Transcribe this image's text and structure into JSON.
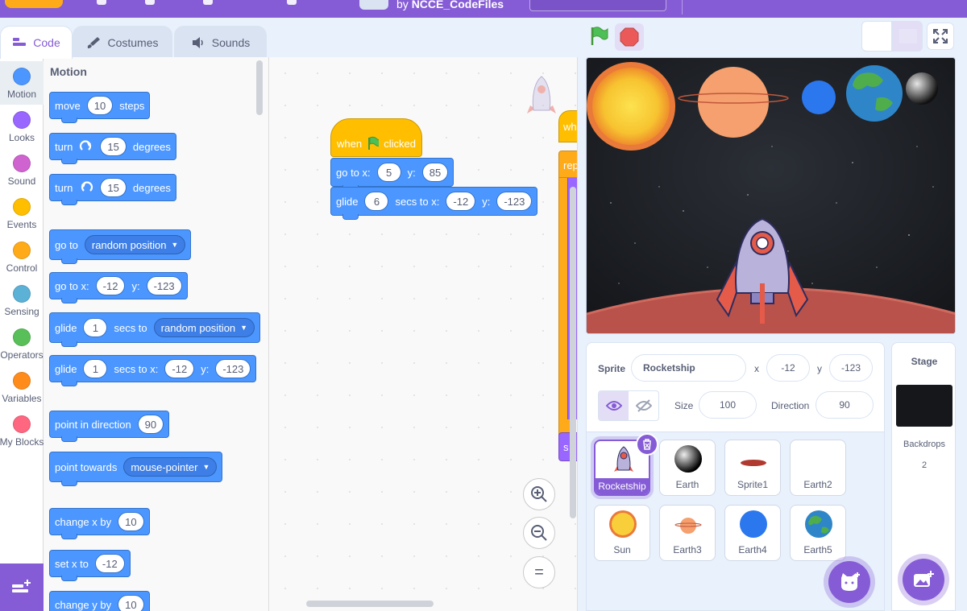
{
  "menubar": {
    "author_prefix": "by",
    "author": "NCCE_CodeFiles"
  },
  "tabs": {
    "code": "Code",
    "costumes": "Costumes",
    "sounds": "Sounds"
  },
  "categories": [
    {
      "label": "Motion",
      "color": "#4c97ff"
    },
    {
      "label": "Looks",
      "color": "#9966ff"
    },
    {
      "label": "Sound",
      "color": "#cf63cf"
    },
    {
      "label": "Events",
      "color": "#ffbf00"
    },
    {
      "label": "Control",
      "color": "#ffab19"
    },
    {
      "label": "Sensing",
      "color": "#5cb1d6"
    },
    {
      "label": "Operators",
      "color": "#59c059"
    },
    {
      "label": "Variables",
      "color": "#ff8c1a"
    },
    {
      "label": "My Blocks",
      "color": "#ff6680"
    }
  ],
  "palette": {
    "title": "Motion",
    "move": {
      "a": "move",
      "v": "10",
      "b": "steps"
    },
    "turn_right": {
      "a": "turn",
      "v": "15",
      "b": "degrees"
    },
    "turn_left": {
      "a": "turn",
      "v": "15",
      "b": "degrees"
    },
    "goto": {
      "a": "go to",
      "dd": "random position"
    },
    "gotoxy": {
      "a": "go to x:",
      "x": "-12",
      "b": "y:",
      "y": "-123"
    },
    "glide_to": {
      "a": "glide",
      "v": "1",
      "b": "secs to",
      "dd": "random position"
    },
    "glide_xy": {
      "a": "glide",
      "v": "1",
      "b": "secs to x:",
      "x": "-12",
      "c": "y:",
      "y": "-123"
    },
    "point_dir": {
      "a": "point in direction",
      "v": "90"
    },
    "point_towards": {
      "a": "point towards",
      "dd": "mouse-pointer"
    },
    "change_x": {
      "a": "change x by",
      "v": "10"
    },
    "set_x": {
      "a": "set x to",
      "v": "-12"
    },
    "change_y": {
      "a": "change y by",
      "v": "10"
    }
  },
  "script": {
    "hat": {
      "a": "when",
      "b": "clicked"
    },
    "gotoxy": {
      "a": "go to x:",
      "x": "5",
      "b": "y:",
      "y": "85"
    },
    "glide": {
      "a": "glide",
      "v": "6",
      "b": "secs to x:",
      "x": "-12",
      "c": "y:",
      "y": "-123"
    },
    "clip_hat": "wh",
    "clip_repeat": "rep",
    "clip_bottom": "s"
  },
  "zoom": {
    "reset": "="
  },
  "sprite_info": {
    "sprite_label": "Sprite",
    "sprite_name": "Rocketship",
    "x_label": "x",
    "x": "-12",
    "y_label": "y",
    "y": "-123",
    "size_label": "Size",
    "size": "100",
    "direction_label": "Direction",
    "direction": "90"
  },
  "sprites": [
    "Rocketship",
    "Earth",
    "Sprite1",
    "Earth2",
    "Sun",
    "Earth3",
    "Earth4",
    "Earth5"
  ],
  "stage_pane": {
    "title": "Stage",
    "backdrops_label": "Backdrops",
    "backdrops_count": "2"
  },
  "colors": {
    "accent": "#855cd6",
    "motion": "#4c97ff",
    "events": "#ffbf00"
  }
}
